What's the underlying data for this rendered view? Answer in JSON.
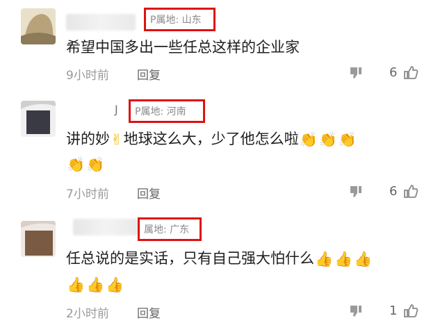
{
  "comments": [
    {
      "ip_label": "P属地: 山东",
      "text": "希望中国多出一些任总这样的企业家",
      "emojis": [],
      "emoji_line2": [],
      "time": "9小时前",
      "reply": "回复",
      "likes": "6"
    },
    {
      "ip_label": "P属地: 河南",
      "text": "讲的妙",
      "text_after": "地球这么大，少了他怎么啦",
      "emojis": [
        "👏",
        "👏",
        "👏"
      ],
      "emoji_line2": [
        "👏",
        "👏"
      ],
      "time": "7小时前",
      "reply": "回复",
      "likes": "6"
    },
    {
      "ip_label": "属地: 广东",
      "text": "任总说的是实话，只有自己强大怕什么",
      "emojis": [
        "👍",
        "👍",
        "👍"
      ],
      "emoji_line2": [
        "👍",
        "👍",
        "👍"
      ],
      "time": "2小时前",
      "reply": "回复",
      "likes": "1"
    }
  ],
  "icons": {
    "dislike": "thumbs-down-icon",
    "like": "thumbs-up-icon",
    "victory_emoji": "✌"
  },
  "colors": {
    "highlight_box": "#e01010",
    "meta_text": "#9a9a9a"
  }
}
